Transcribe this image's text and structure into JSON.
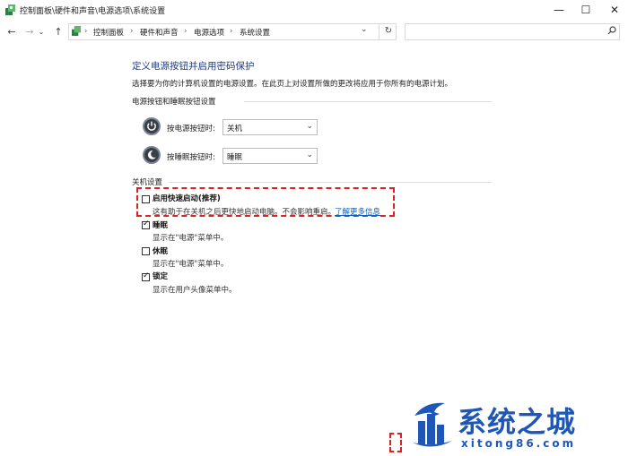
{
  "window": {
    "title": "控制面板\\硬件和声音\\电源选项\\系统设置",
    "minimize_glyph": "—",
    "maximize_glyph": "☐",
    "close_glyph": "✕"
  },
  "address_bar": {
    "breadcrumbs": [
      "控制面板",
      "硬件和声音",
      "电源选项",
      "系统设置"
    ],
    "separator": "›",
    "search_placeholder": "",
    "search_icon": "search-icon"
  },
  "content": {
    "heading": "定义电源按钮并启用密码保护",
    "description": "选择要为你的计算机设置的电源设置。在此页上对设置所做的更改将应用于你所有的电源计划。",
    "power_section": {
      "title": "电源按钮和睡眠按钮设置",
      "rows": [
        {
          "label": "按电源按钮时:",
          "value": "关机",
          "icon": "power-icon"
        },
        {
          "label": "按睡眠按钮时:",
          "value": "睡眠",
          "icon": "sleep-icon"
        }
      ]
    },
    "shutdown_section": {
      "title": "关机设置",
      "options": [
        {
          "title": "启用快速启动(推荐)",
          "desc": "这有助于在关机之后更快地启动电脑。不会影响重启。",
          "link": "了解更多信息",
          "checked": false
        },
        {
          "title": "睡眠",
          "desc": "显示在\"电源\"菜单中。",
          "checked": true
        },
        {
          "title": "休眠",
          "desc": "显示在\"电源\"菜单中。",
          "checked": false
        },
        {
          "title": "锁定",
          "desc": "显示在用户头像菜单中。",
          "checked": true
        }
      ]
    }
  },
  "watermark": {
    "text": "系统之城",
    "url": "xitong86.com"
  },
  "colors": {
    "heading": "#1e3c82",
    "link": "#0b5fc1",
    "highlight": "#e02020",
    "watermark": "#1f57b8"
  }
}
